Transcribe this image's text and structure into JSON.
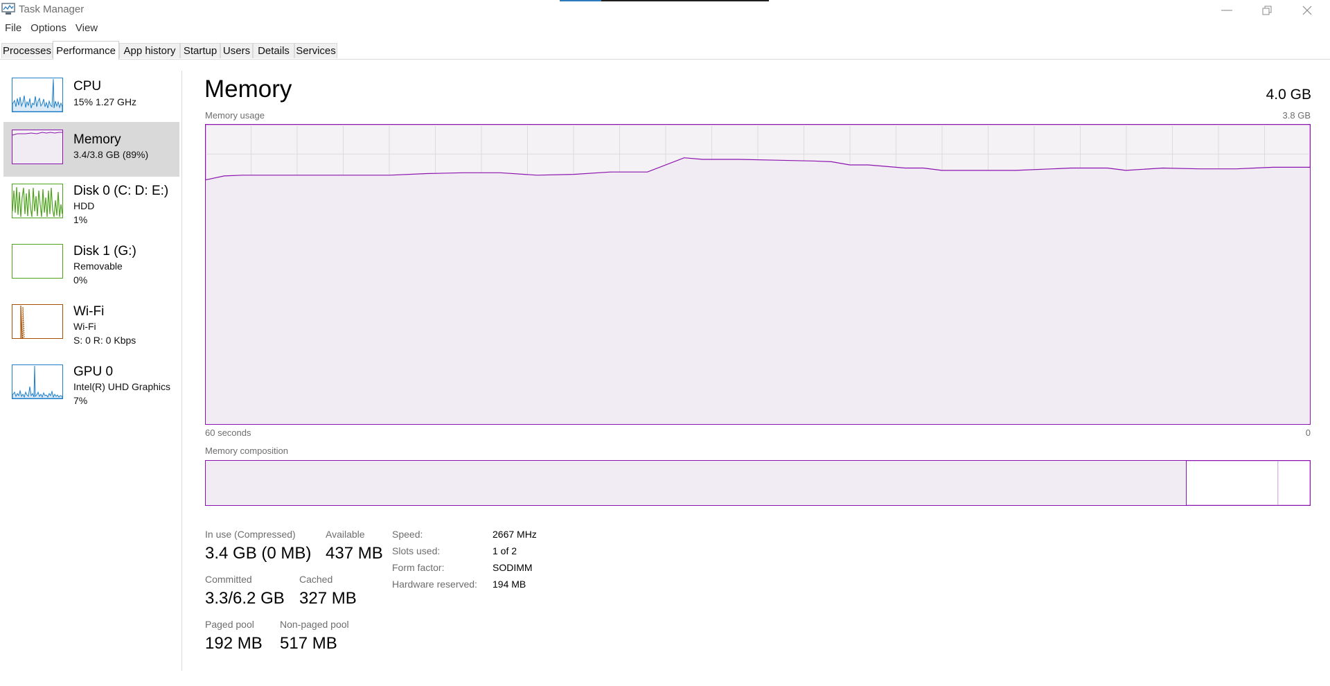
{
  "window": {
    "title": "Task Manager"
  },
  "menu": [
    "File",
    "Options",
    "View"
  ],
  "tabs": [
    "Processes",
    "Performance",
    "App history",
    "Startup",
    "Users",
    "Details",
    "Services"
  ],
  "active_tab": "Performance",
  "sidebar": {
    "items": [
      {
        "title": "CPU",
        "line1": "15%  1.27 GHz",
        "line2": "",
        "color": "#1e7fc8",
        "icon": "cpu-graph-icon"
      },
      {
        "title": "Memory",
        "line1": "3.4/3.8 GB (89%)",
        "line2": "",
        "color": "#8b12ae",
        "icon": "memory-graph-icon",
        "selected": true
      },
      {
        "title": "Disk 0 (C: D: E:)",
        "line1": "HDD",
        "line2": "1%",
        "color": "#4da41a",
        "icon": "disk-graph-icon"
      },
      {
        "title": "Disk 1 (G:)",
        "line1": "Removable",
        "line2": "0%",
        "color": "#4da41a",
        "icon": "disk-graph-icon"
      },
      {
        "title": "Wi-Fi",
        "line1": "Wi-Fi",
        "line2": "S: 0  R: 0 Kbps",
        "color": "#a74f01",
        "icon": "network-graph-icon"
      },
      {
        "title": "GPU 0",
        "line1": "Intel(R) UHD Graphics",
        "line2": "7%",
        "color": "#1e7fc8",
        "icon": "gpu-graph-icon"
      }
    ]
  },
  "memory": {
    "title": "Memory",
    "total": "4.0 GB",
    "usage_label": "Memory usage",
    "usage_max": "3.8 GB",
    "time_left": "60 seconds",
    "time_right": "0",
    "composition_label": "Memory composition",
    "accent_color": "#8b12ae",
    "fill_color": "#f4f2f4",
    "composition": {
      "in_use_fraction": 0.888,
      "modified_fraction": 0.083
    },
    "stats": {
      "in_use_label": "In use (Compressed)",
      "in_use_value": "3.4 GB (0 MB)",
      "available_label": "Available",
      "available_value": "437 MB",
      "committed_label": "Committed",
      "committed_value": "3.3/6.2 GB",
      "cached_label": "Cached",
      "cached_value": "327 MB",
      "paged_label": "Paged pool",
      "paged_value": "192 MB",
      "nonpaged_label": "Non-paged pool",
      "nonpaged_value": "517 MB"
    },
    "hardware": [
      {
        "label": "Speed:",
        "value": "2667 MHz"
      },
      {
        "label": "Slots used:",
        "value": "1 of 2"
      },
      {
        "label": "Form factor:",
        "value": "SODIMM"
      },
      {
        "label": "Hardware reserved:",
        "value": "194 MB"
      }
    ]
  },
  "chart_data": {
    "type": "area",
    "ylabel": "Memory usage",
    "ylim": [
      0,
      3.8
    ],
    "xlim": [
      60,
      0
    ],
    "x": [
      60,
      59,
      58,
      56,
      54,
      52,
      50,
      48,
      46,
      44,
      42,
      40,
      38,
      36,
      34,
      33,
      32,
      31,
      29,
      27,
      26,
      25,
      24,
      22,
      21,
      20,
      18,
      16,
      14,
      13,
      12,
      11,
      10,
      8,
      6,
      5,
      4,
      3,
      2,
      1,
      0
    ],
    "series": [
      {
        "values": [
          3.1,
          3.15,
          3.16,
          3.16,
          3.16,
          3.16,
          3.16,
          3.18,
          3.19,
          3.19,
          3.16,
          3.17,
          3.2,
          3.2,
          3.38,
          3.36,
          3.36,
          3.36,
          3.35,
          3.34,
          3.33,
          3.29,
          3.29,
          3.25,
          3.25,
          3.22,
          3.22,
          3.22,
          3.24,
          3.25,
          3.25,
          3.25,
          3.22,
          3.25,
          3.24,
          3.24,
          3.24,
          3.25,
          3.26,
          3.26,
          3.26
        ]
      }
    ],
    "grid": true
  }
}
